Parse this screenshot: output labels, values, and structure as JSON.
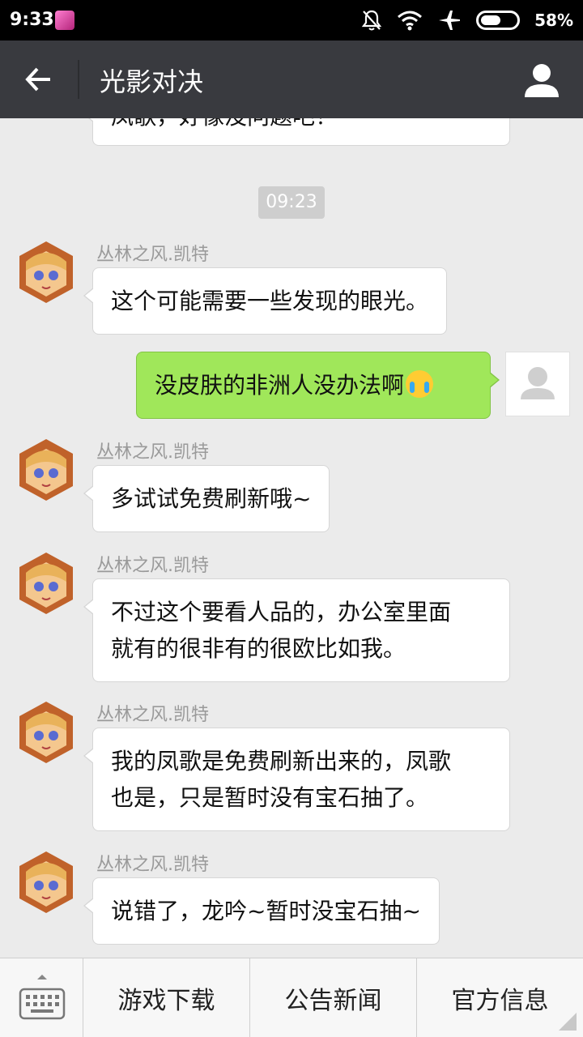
{
  "status_bar": {
    "time": "9:33",
    "battery": "58%",
    "battery_level": 0.58
  },
  "app_bar": {
    "title": "光影对决"
  },
  "chat": {
    "partial_message": "凤歌，好像没问题吧！",
    "timestamp": "09:23",
    "messages": [
      {
        "sender": "丛林之风.凯特",
        "lines": [
          "这个可能需要一些发现的眼光。"
        ]
      },
      {
        "outgoing": true,
        "text": "没皮肤的非洲人没办法啊"
      },
      {
        "sender": "丛林之风.凯特",
        "lines": [
          "多试试免费刷新哦~"
        ]
      },
      {
        "sender": "丛林之风.凯特",
        "lines": [
          "不过这个要看人品的，办公室里面",
          "就有的很非有的很欧比如我。"
        ]
      },
      {
        "sender": "丛林之风.凯特",
        "lines": [
          "我的凤歌是免费刷新出来的，凤歌",
          "也是，只是暂时没有宝石抽了。"
        ]
      },
      {
        "sender": "丛林之风.凯特",
        "lines": [
          "说错了，龙吟~暂时没宝石抽~"
        ]
      }
    ]
  },
  "bottom_menu": {
    "keyboard_icon": "keyboard-icon",
    "items": [
      "游戏下载",
      "公告新闻",
      "官方信息"
    ]
  }
}
